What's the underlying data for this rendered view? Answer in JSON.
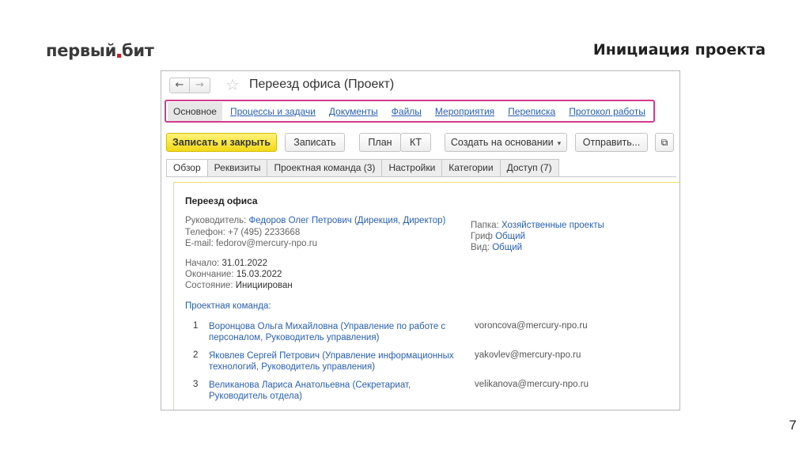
{
  "slide": {
    "logo_left": "первый",
    "logo_right": "бит",
    "title": "Инициация проекта",
    "page_number": "7"
  },
  "window": {
    "title": "Переезд офиса (Проект)",
    "back_glyph": "←",
    "forward_glyph": "→",
    "star_glyph": "☆"
  },
  "nav_tabs": [
    "Основное",
    "Процессы и задачи",
    "Документы",
    "Файлы",
    "Мероприятия",
    "Переписка",
    "Протокол работы"
  ],
  "toolbar": {
    "save_close": "Записать и закрыть",
    "save": "Записать",
    "plan": "План",
    "kt": "КТ",
    "create_based": "Создать на основании",
    "create_caret": "▾",
    "send": "Отправить...",
    "extra_glyph": "⧉"
  },
  "form_tabs": [
    "Обзор",
    "Реквизиты",
    "Проектная команда (3)",
    "Настройки",
    "Категории",
    "Доступ (7)"
  ],
  "overview": {
    "project_title": "Переезд офиса",
    "manager_label": "Руководитель:",
    "manager_value": "Федоров Олег Петрович (Дирекция, Директор)",
    "phone_label": "Телефон:",
    "phone_value": "+7 (495) 2233668",
    "email_label": "E-mail:",
    "email_value": "fedorov@mercury-npo.ru",
    "start_label": "Начало:",
    "start_value": "31.01.2022",
    "end_label": "Окончание:",
    "end_value": "15.03.2022",
    "state_label": "Состояние:",
    "state_value": "Инициирован",
    "folder_label": "Папка:",
    "folder_value": "Хозяйственные проекты",
    "grif_label": "Гриф",
    "grif_value": "Общий",
    "view_label": "Вид:",
    "view_value": "Общий",
    "team_label": "Проектная команда:",
    "team": [
      {
        "num": "1",
        "name_line1": "Воронцова Ольга Михайловна (Управление по работе с",
        "name_line2": "персоналом, Руководитель управления)",
        "email": "voroncova@mercury-npo.ru"
      },
      {
        "num": "2",
        "name_line1": "Яковлев Сергей Петрович (Управление информационных",
        "name_line2": "технологий, Руководитель управления)",
        "email": "yakovlev@mercury-npo.ru"
      },
      {
        "num": "3",
        "name_line1": "Великанова Лариса Анатольевна (Секретариат,",
        "name_line2": "Руководитель отдела)",
        "email": "velikanova@mercury-npo.ru"
      }
    ]
  }
}
